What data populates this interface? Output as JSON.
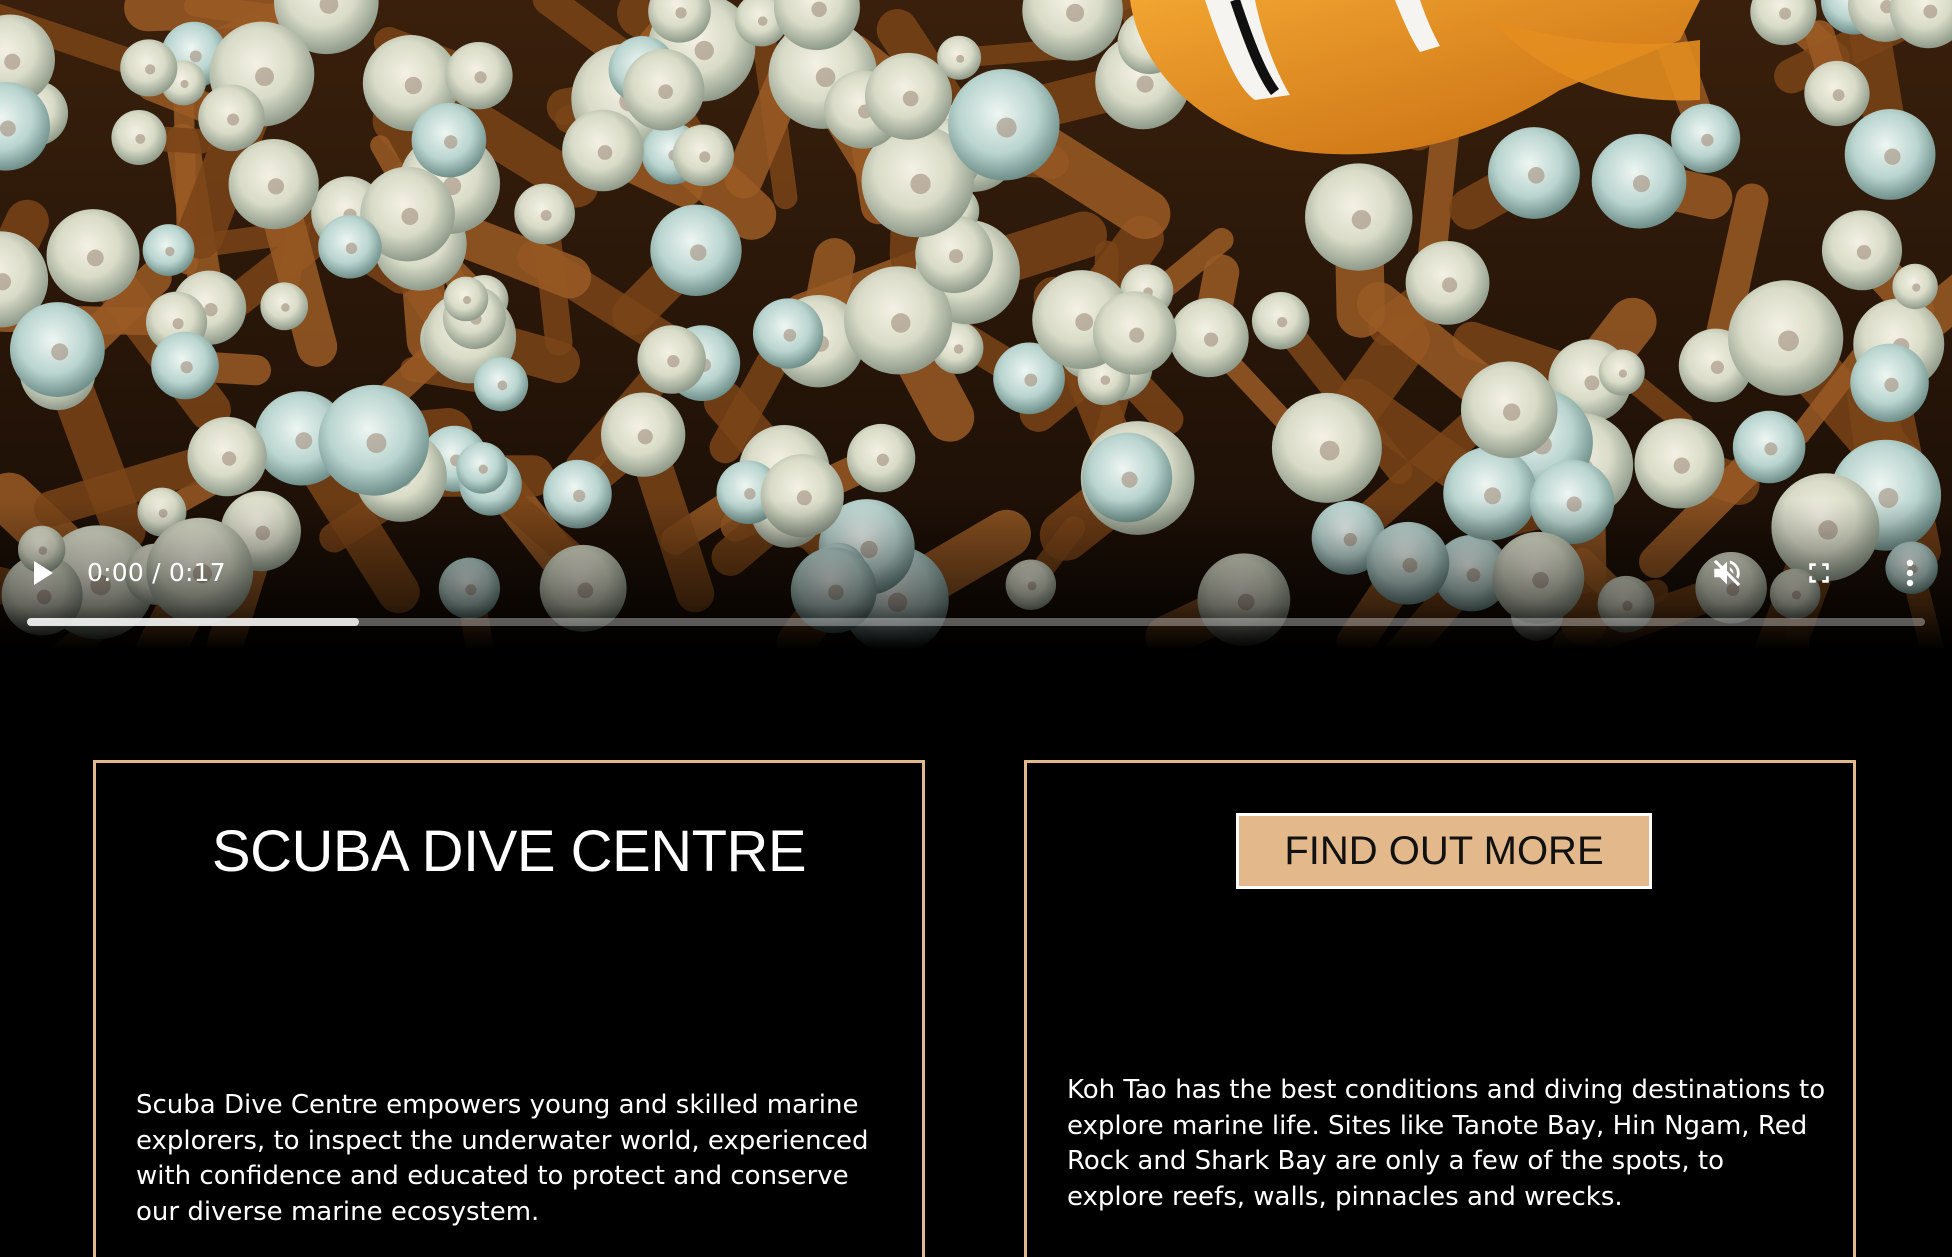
{
  "video": {
    "current_time": "0:00",
    "duration": "0:17",
    "time_display": "0:00 / 0:17",
    "buffered_fraction": 0.175,
    "play_icon": "play-icon",
    "mute_icon": "volume-muted-icon",
    "fullscreen_icon": "fullscreen-icon",
    "menu_icon": "more-vertical-icon"
  },
  "about_card": {
    "title": "SCUBA DIVE CENTRE",
    "text": "Scuba Dive Centre empowers young and skilled marine explorers, to inspect the underwater world, experienced with confidence and educated to protect and conserve our diverse marine ecosystem."
  },
  "info_card": {
    "button_label": "FIND OUT MORE",
    "text": "Koh Tao has the best conditions and diving destinations to explore marine life. Sites like Tanote Bay, Hin Ngam, Red Rock and Shark Bay are only a few of the spots, to explore reefs, walls, pinnacles and wrecks."
  },
  "colors": {
    "accent": "#e3b98c",
    "background": "#000000",
    "text": "#ffffff"
  }
}
